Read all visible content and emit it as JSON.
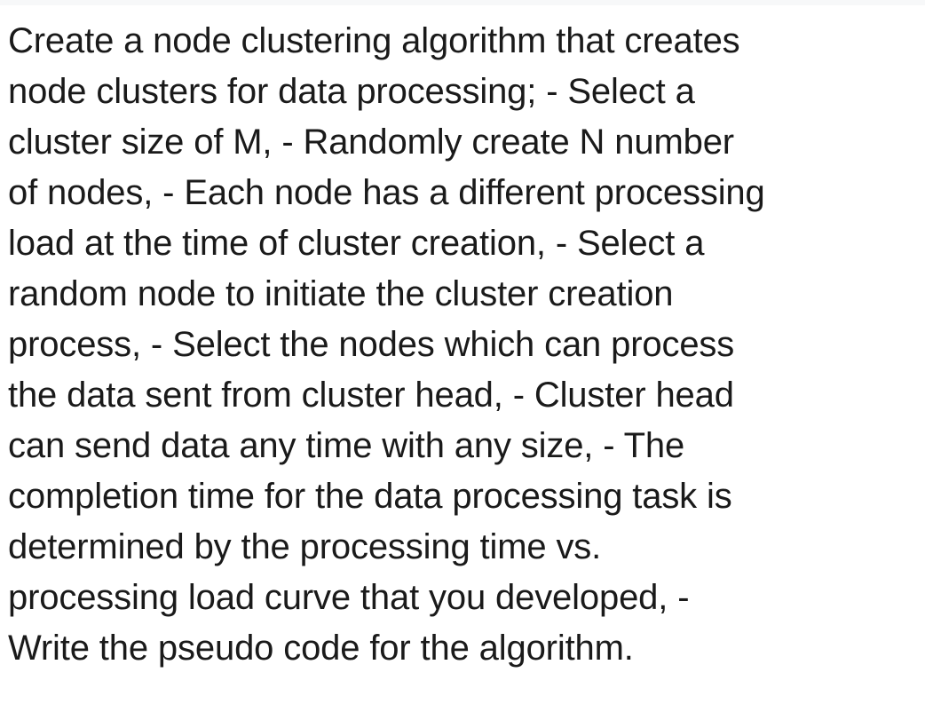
{
  "page": {
    "background_color": "#ffffff",
    "top_strip_color": "#f7f8f9",
    "text_color": "#1a1a1a"
  },
  "prompt": {
    "full_text": "Create a node clustering algorithm that creates node clusters for data processing; - Select a cluster size of M, - Randomly create N number of nodes, - Each node has a different processing load at the time of cluster creation, - Select a random node to initiate the cluster creation process, - Select the nodes which can process the data sent from cluster head, - Cluster head can send data any time with any size, - The completion time for the data processing task is determined by the processing time vs. processing load curve that you developed, - Write the pseudo code for the algorithm.",
    "lines": [
      "Create a node clustering algorithm that creates",
      "node clusters for data processing; - Select a",
      "cluster size of M, - Randomly create N number",
      "of nodes, - Each node has a different processing",
      "load at the time of cluster creation, - Select a",
      "random node to initiate the cluster creation",
      "process, - Select the nodes which can process",
      "the data sent from cluster head, - Cluster head",
      "can send data any time with any size, - The",
      "completion time for the data processing task is",
      "determined by the processing time vs.",
      "processing load curve that you developed, -",
      "Write the pseudo code for the algorithm."
    ]
  }
}
